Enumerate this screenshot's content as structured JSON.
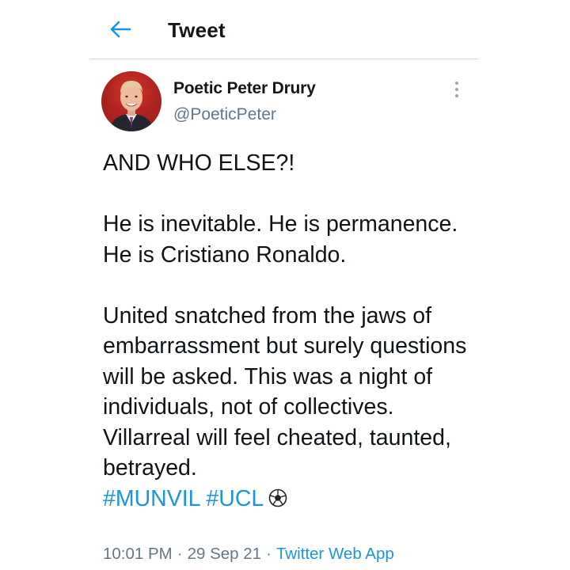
{
  "header": {
    "back_icon": "arrow-left-icon",
    "title": "Tweet"
  },
  "author": {
    "avatar_icon": "profile-photo",
    "display_name": "Poetic Peter Drury",
    "handle": "@PoeticPeter",
    "more_icon": "more-vertical-icon"
  },
  "tweet": {
    "line1": "AND WHO ELSE?!",
    "para2": "He is inevitable. He is permanence. He is Cristiano Ronaldo.",
    "para3": "United snatched from the jaws of embarrassment but surely questions will be asked. This was a night of individuals, not of collectives. Villarreal will feel cheated, taunted, betrayed.",
    "hashtags": [
      "#MUNVIL",
      "#UCL"
    ],
    "emoji_icon": "soccer-ball-icon"
  },
  "meta": {
    "time": "10:01 PM",
    "date": "29 Sep 21",
    "source": "Twitter Web App"
  },
  "colors": {
    "accent": "#1b95e0",
    "secondary_text": "#657786",
    "primary_text": "#0f1419",
    "divider": "#d9d9d9"
  }
}
